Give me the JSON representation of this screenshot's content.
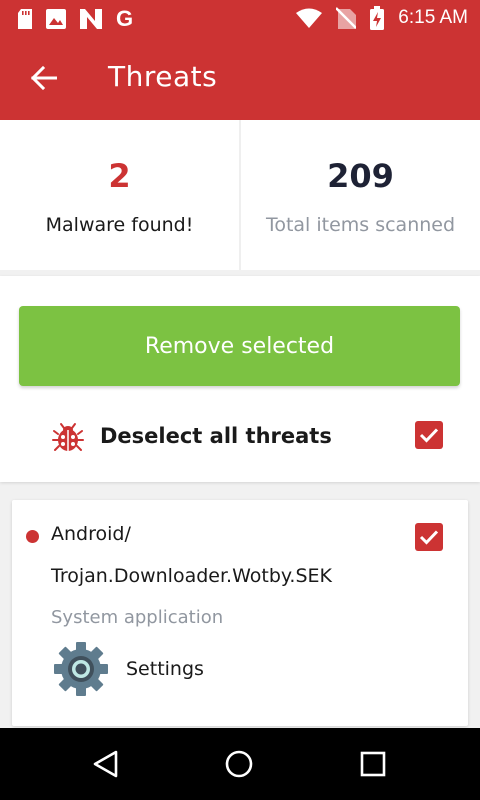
{
  "status_bar": {
    "time": "6:15 AM",
    "left_icons": [
      "sd-card-icon",
      "image-icon",
      "n-app-icon",
      "google-g-icon"
    ],
    "right_icons": [
      "wifi-icon",
      "no-signal-icon",
      "battery-charging-icon"
    ]
  },
  "app_bar": {
    "title": "Threats",
    "back_icon": "arrow-left-icon",
    "color": "#cc3333"
  },
  "stats": {
    "malware": {
      "value": "2",
      "label": "Malware found!"
    },
    "scanned": {
      "value": "209",
      "label": "Total items scanned"
    }
  },
  "actions": {
    "remove_label": "Remove selected",
    "remove_color": "#7cc242",
    "deselect_label": "Deselect all threats",
    "deselect_checked": true
  },
  "threats": [
    {
      "name_line1": "Android/",
      "name_line2": "Trojan.Downloader.Wotby.SEK",
      "type": "System application",
      "app_name": "Settings",
      "app_icon": "settings-gear-icon",
      "checked": true
    }
  ],
  "nav_bar": {
    "icons": [
      "back-triangle-icon",
      "home-circle-icon",
      "recents-square-icon"
    ]
  }
}
